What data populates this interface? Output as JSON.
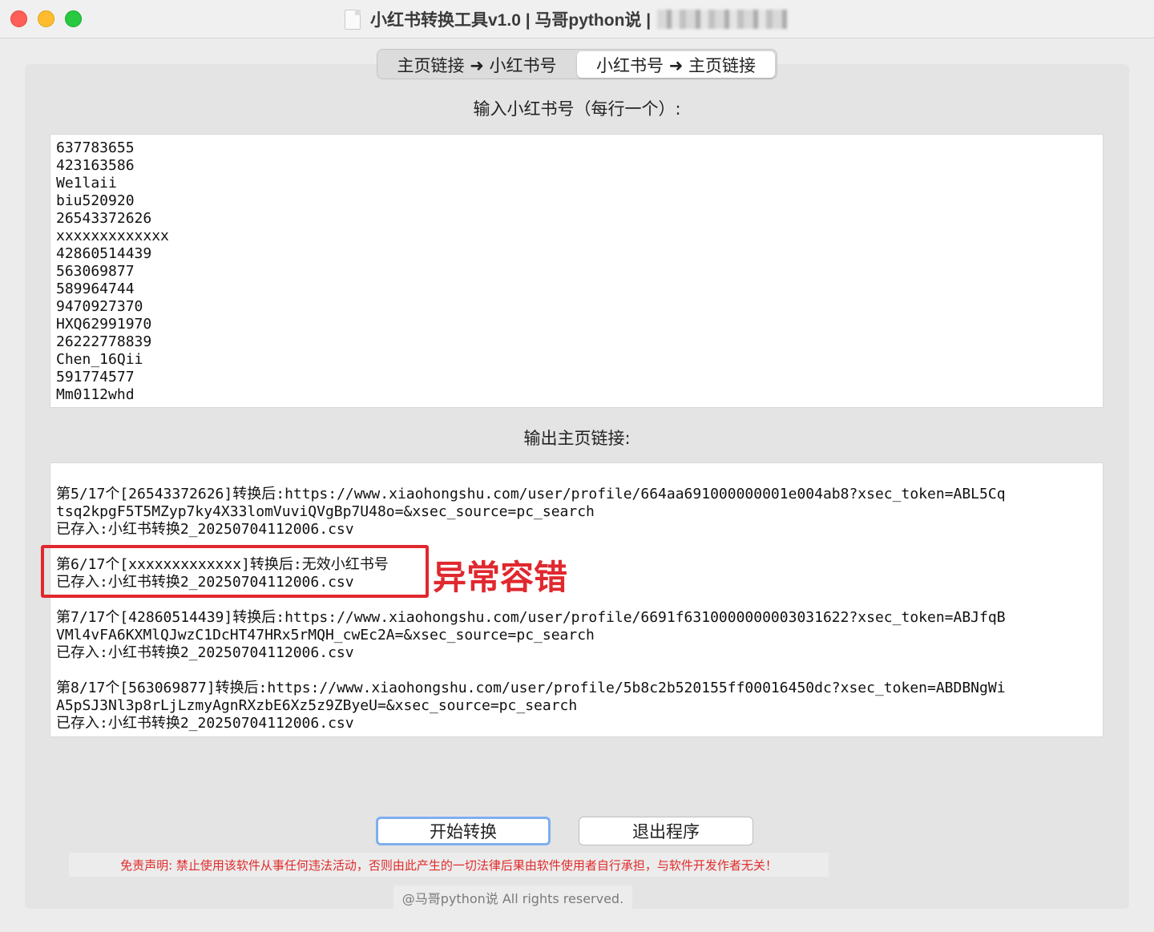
{
  "window": {
    "title": "小红书转换工具v1.0 | 马哥python说 |"
  },
  "tabs": [
    {
      "label": "主页链接 ➜ 小红书号"
    },
    {
      "label": "小红书号 ➜ 主页链接",
      "selected": true
    }
  ],
  "input": {
    "label": "输入小红书号（每行一个）:",
    "lines": [
      "637783655",
      "423163586",
      "We1laii",
      "biu520920",
      "26543372626",
      "xxxxxxxxxxxxx",
      "42860514439",
      "563069877",
      "589964744",
      "9470927370",
      "HXQ62991970",
      "26222778839",
      "Chen_16Qii",
      "591774577",
      "Mm0112whd"
    ]
  },
  "output": {
    "label": "输出主页链接:",
    "entries": [
      [
        "第5/17个[26543372626]转换后:https://www.xiaohongshu.com/user/profile/664aa691000000001e004ab8?xsec_token=ABL5Cq",
        "tsq2kpgF5T5MZyp7ky4X33lomVuviQVgBp7U48o=&xsec_source=pc_search",
        "已存入:小红书转换2_20250704112006.csv"
      ],
      [
        "第6/17个[xxxxxxxxxxxxx]转换后:无效小红书号",
        "已存入:小红书转换2_20250704112006.csv"
      ],
      [
        "第7/17个[42860514439]转换后:https://www.xiaohongshu.com/user/profile/6691f6310000000003031622?xsec_token=ABJfqB",
        "VMl4vFA6KXMlQJwzC1DcHT47HRx5rMQH_cwEc2A=&xsec_source=pc_search",
        "已存入:小红书转换2_20250704112006.csv"
      ],
      [
        "第8/17个[563069877]转换后:https://www.xiaohongshu.com/user/profile/5b8c2b520155ff00016450dc?xsec_token=ABDBNgWi",
        "A5pSJ3Nl3p8rLjLzmyAgnRXzbE6Xz5z9ZByeU=&xsec_source=pc_search",
        "已存入:小红书转换2_20250704112006.csv"
      ]
    ]
  },
  "annotation": {
    "text": "异常容错",
    "color": "#e0282e"
  },
  "buttons": {
    "start": "开始转换",
    "exit": "退出程序"
  },
  "footer": {
    "disclaimer": "免责声明: 禁止使用该软件从事任何违法活动，否则由此产生的一切法律后果由软件使用者自行承担，与软件开发作者无关！",
    "copyright": "@马哥python说 All rights reserved."
  },
  "colors": {
    "accent": "#7eaef0",
    "warning": "#e12b2b"
  }
}
